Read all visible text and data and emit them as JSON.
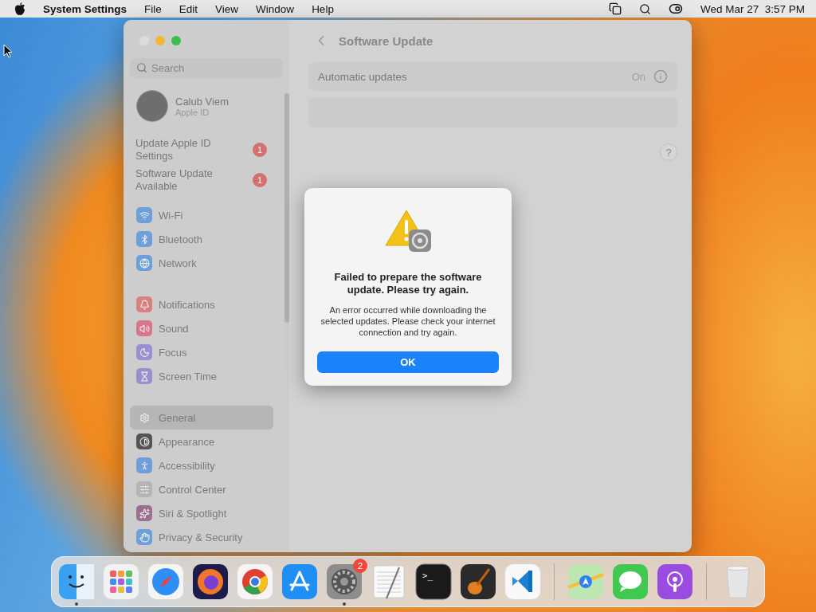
{
  "menu_bar": {
    "app_name": "System Settings",
    "menus": [
      "File",
      "Edit",
      "View",
      "Window",
      "Help"
    ],
    "clock": "Wed Mar 27  3:57 PM"
  },
  "window": {
    "title": "Software Update",
    "search": {
      "placeholder": "Search"
    },
    "account": {
      "name": "Calub Viem",
      "subtitle": "Apple ID"
    },
    "notices": [
      {
        "label": "Update Apple ID Settings",
        "badge": "1"
      },
      {
        "label": "Software Update Available",
        "badge": "1"
      }
    ],
    "sidebar_groups": [
      [
        {
          "label": "Wi-Fi",
          "color": "#6f9fd8",
          "selected": false
        },
        {
          "label": "Bluetooth",
          "color": "#6f9fd8",
          "selected": false
        },
        {
          "label": "Network",
          "color": "#6f9fd8",
          "selected": false
        }
      ],
      [
        {
          "label": "Notifications",
          "color": "#d98080",
          "selected": false
        },
        {
          "label": "Sound",
          "color": "#d9778a",
          "selected": false
        },
        {
          "label": "Focus",
          "color": "#9a8fcf",
          "selected": false
        },
        {
          "label": "Screen Time",
          "color": "#9a8fcf",
          "selected": false
        }
      ],
      [
        {
          "label": "General",
          "color": "#b5b5b5",
          "selected": true
        },
        {
          "label": "Appearance",
          "color": "#555555",
          "selected": false
        },
        {
          "label": "Accessibility",
          "color": "#6f9fd8",
          "selected": false
        },
        {
          "label": "Control Center",
          "color": "#b5b5b5",
          "selected": false
        },
        {
          "label": "Siri & Spotlight",
          "color": "#9a6f8f",
          "selected": false
        },
        {
          "label": "Privacy & Security",
          "color": "#6f9fd8",
          "selected": false
        }
      ]
    ],
    "rows": [
      {
        "label": "Automatic updates",
        "value": "On"
      }
    ],
    "help": "?"
  },
  "dialog": {
    "title": "Failed to prepare the software update. Please try again.",
    "message": "An error occurred while downloading the selected updates. Please check your internet connection and try again.",
    "button": "OK"
  },
  "dock": [
    {
      "kind": "finder",
      "running": true
    },
    {
      "kind": "launchpad",
      "running": false
    },
    {
      "kind": "safari",
      "running": false
    },
    {
      "kind": "firefox",
      "running": false
    },
    {
      "kind": "chrome",
      "running": false
    },
    {
      "kind": "appstore",
      "running": false
    },
    {
      "kind": "settings",
      "running": true,
      "badge": "2"
    },
    {
      "kind": "textedit",
      "running": false
    },
    {
      "kind": "terminal",
      "running": false,
      "glyph": ">_"
    },
    {
      "kind": "garageband",
      "running": false
    },
    {
      "kind": "vscode",
      "running": false
    },
    {
      "kind": "separator"
    },
    {
      "kind": "maps",
      "running": false
    },
    {
      "kind": "messages",
      "running": false
    },
    {
      "kind": "podcasts",
      "running": false
    },
    {
      "kind": "separator"
    },
    {
      "kind": "trash",
      "running": false
    }
  ]
}
